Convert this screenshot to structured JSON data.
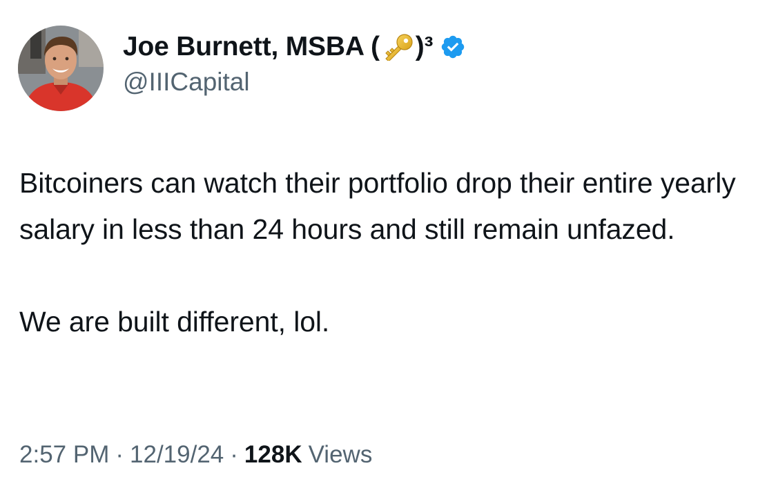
{
  "author": {
    "name": "Joe Burnett, MSBA (",
    "name_suffix": ")³",
    "handle": "@IIICapital",
    "avatar_icon": "profile-photo",
    "badge_icon": "verified-badge-icon",
    "badge_color": "#1d9bf0",
    "emoji_icon": "key-emoji-icon"
  },
  "tweet": {
    "paragraphs": [
      "Bitcoiners can watch their portfolio drop their entire yearly salary in less than 24 hours and still remain unfazed.",
      "We are built different, lol."
    ]
  },
  "meta": {
    "time": "2:57 PM",
    "separator": "·",
    "date": "12/19/24",
    "views_count": "128K",
    "views_label": "Views"
  },
  "colors": {
    "text_primary": "#0f1419",
    "text_secondary": "#536471",
    "verified": "#1d9bf0"
  }
}
